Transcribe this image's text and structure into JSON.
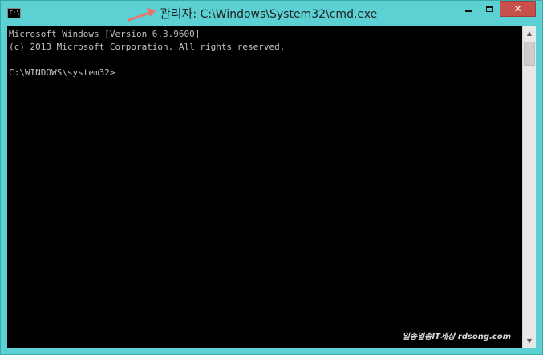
{
  "window": {
    "title_admin": "관리자",
    "title_path": ": C:\\Windows\\System32\\cmd.exe",
    "icon_text": "C:\\",
    "controls": {
      "minimize": "minimize-icon",
      "maximize": "maximize-icon",
      "close": "✕"
    }
  },
  "console": {
    "lines": [
      "Microsoft Windows [Version 6.3.9600]",
      "(c) 2013 Microsoft Corporation. All rights reserved.",
      "",
      "C:\\WINDOWS\\system32>"
    ]
  },
  "watermark": "일송일송IT세상 rdsong.com",
  "scrollbar": {
    "up": "▲",
    "down": "▼"
  },
  "colors": {
    "frame": "#5bd1d3",
    "close": "#c7504a",
    "console_bg": "#000000",
    "console_text": "#c0c0c0"
  }
}
